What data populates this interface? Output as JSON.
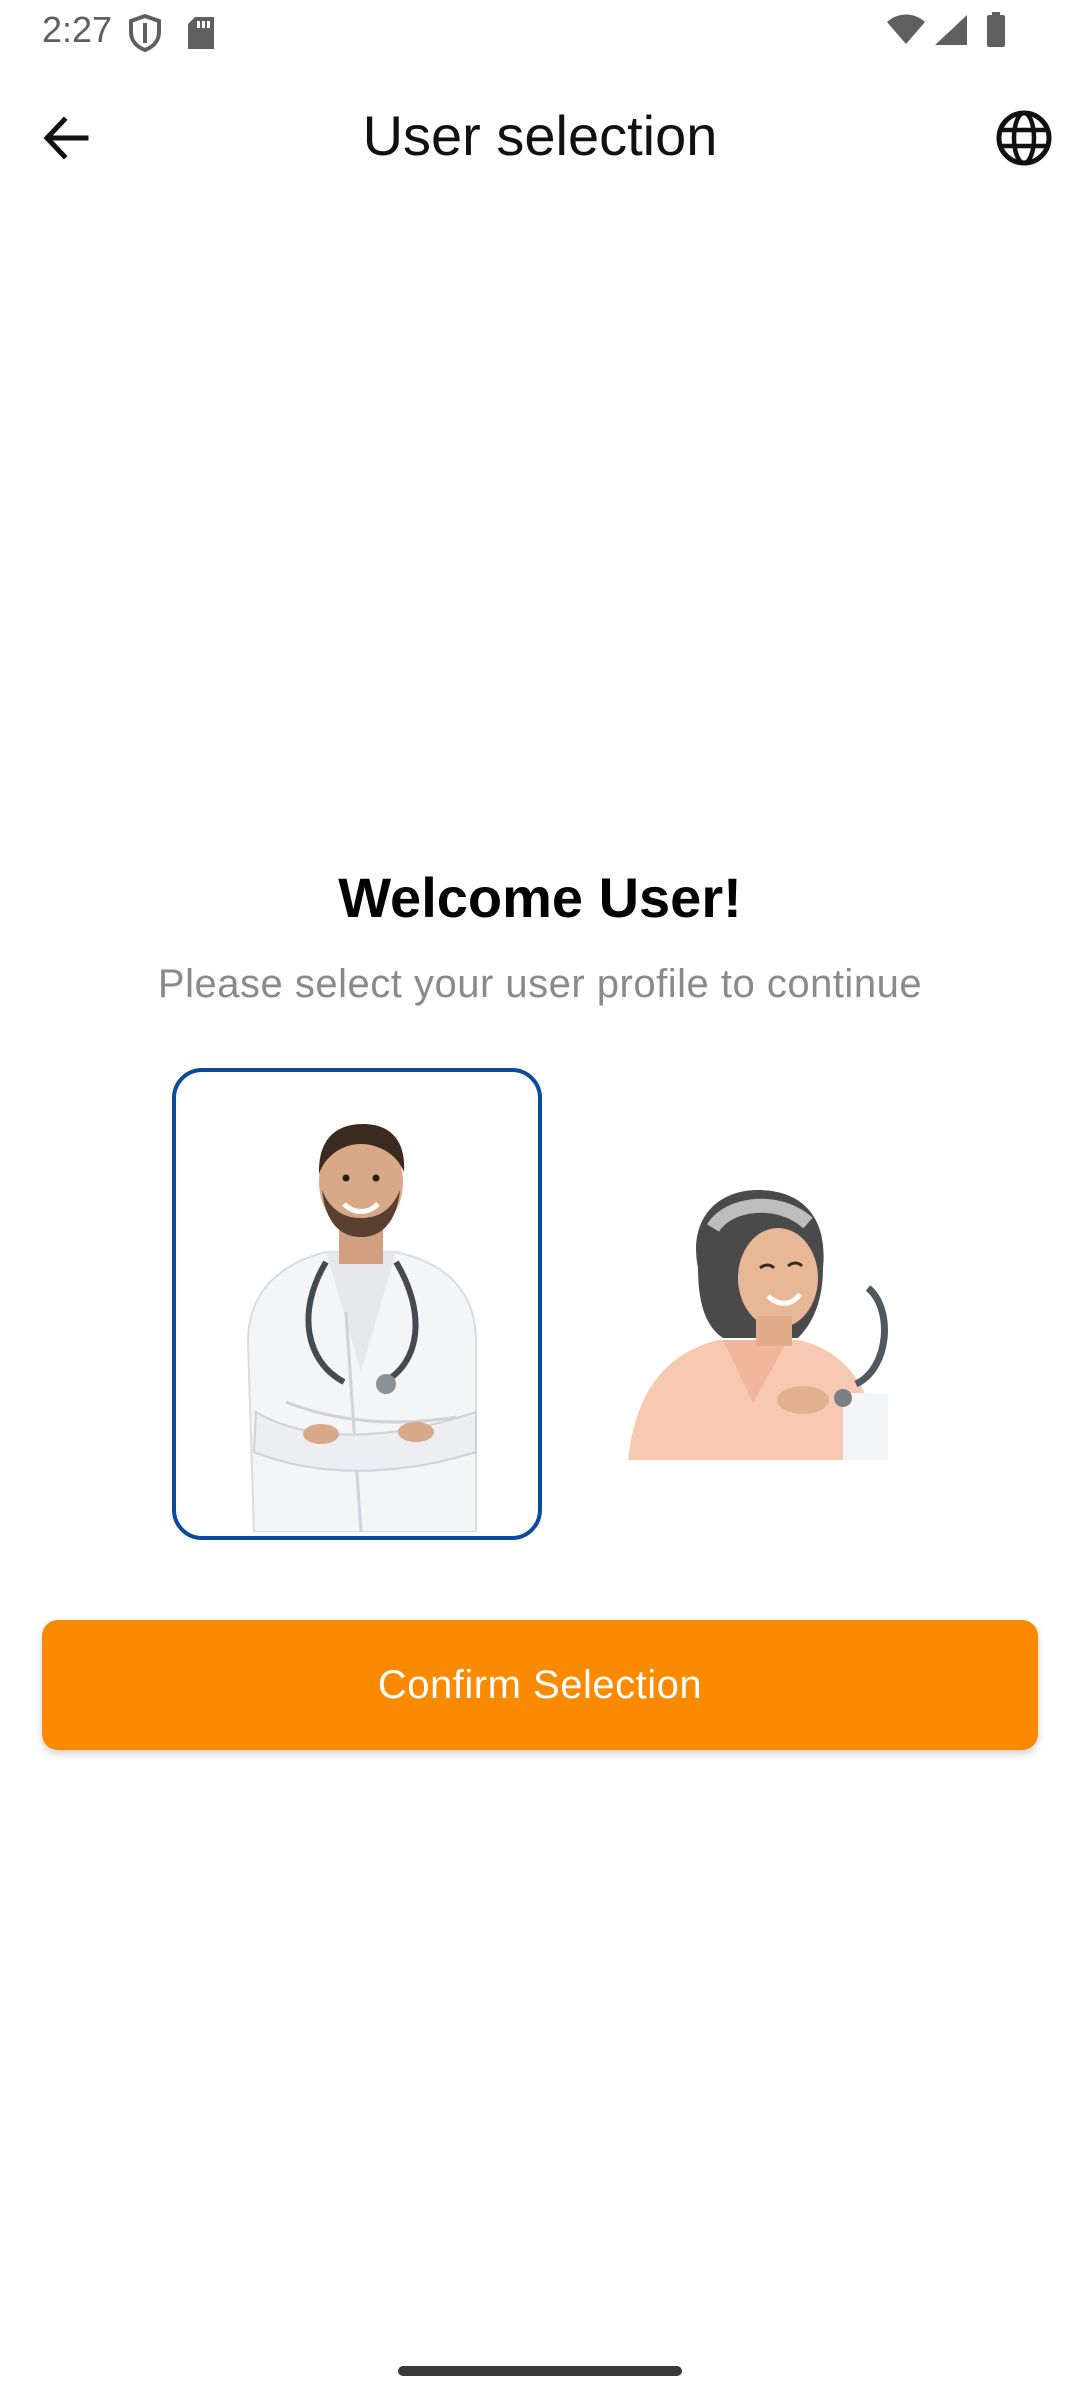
{
  "status_bar": {
    "time": "2:27",
    "left_icons": [
      "shield-icon",
      "sd-card-icon"
    ],
    "right_icons": [
      "wifi-icon",
      "cell-signal-icon",
      "battery-icon"
    ]
  },
  "app_bar": {
    "title": "User selection",
    "back_icon": "arrow-back-icon",
    "language_icon": "globe-icon"
  },
  "welcome": {
    "title": "Welcome User!",
    "subtitle": "Please select your user profile to continue"
  },
  "profiles": [
    {
      "kind": "doctor",
      "selected": true
    },
    {
      "kind": "patient",
      "selected": false
    }
  ],
  "confirm_button": {
    "label": "Confirm Selection"
  },
  "colors": {
    "accent": "#fb8a00",
    "selection_border": "#0b4a9c",
    "subtitle_text": "#8a8a8a"
  }
}
